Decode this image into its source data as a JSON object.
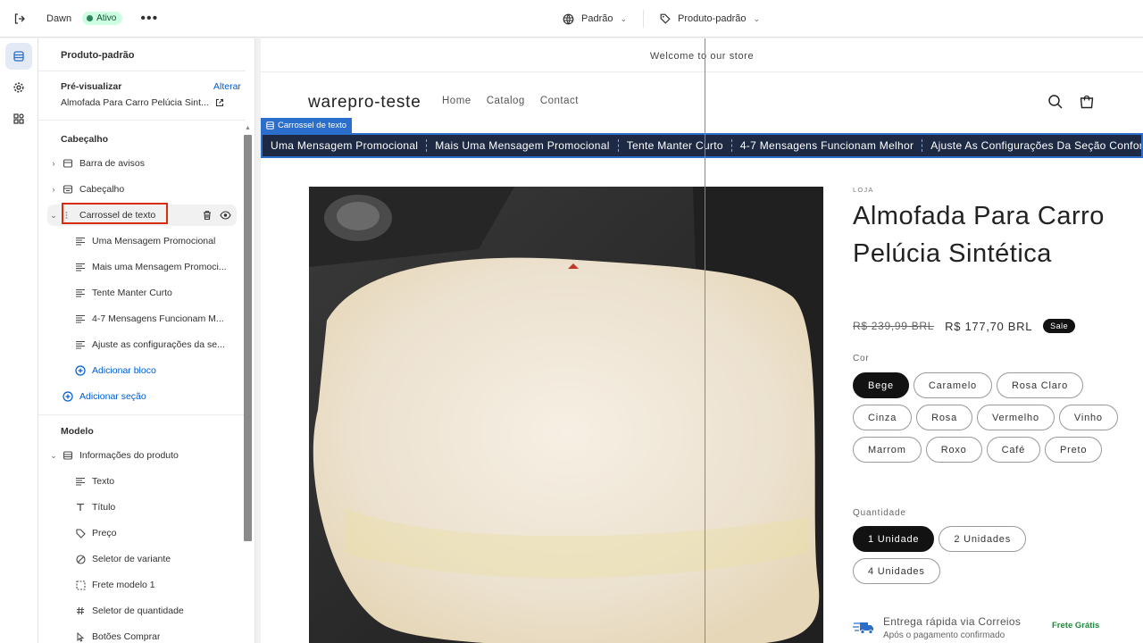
{
  "topbar": {
    "theme_name": "Dawn",
    "status": "Ativo",
    "more": "•••",
    "language_label": "Padrão",
    "template_label": "Produto-padrão"
  },
  "sidebar": {
    "title": "Produto-padrão",
    "preview_label": "Pré-visualizar",
    "change_label": "Alterar",
    "preview_product": "Almofada Para Carro Pelúcia Sint...",
    "header_section_title": "Cabeçalho",
    "header_items": [
      "Barra de avisos",
      "Cabeçalho",
      "Carrossel de texto"
    ],
    "carousel_blocks": [
      "Uma Mensagem Promocional",
      "Mais uma Mensagem Promoci...",
      "Tente Manter Curto",
      "4-7 Mensagens Funcionam M...",
      "Ajuste as configurações da se..."
    ],
    "add_block": "Adicionar bloco",
    "add_section": "Adicionar seção",
    "template_section_title": "Modelo",
    "product_info": "Informações do produto",
    "product_blocks": [
      "Texto",
      "Título",
      "Preço",
      "Seletor de variante",
      "Frete modelo 1",
      "Seletor de quantidade",
      "Botões Comprar"
    ]
  },
  "preview": {
    "announcement": "Welcome to our store",
    "store_name": "warepro-teste",
    "nav": [
      "Home",
      "Catalog",
      "Contact"
    ],
    "carousel_tag": "Carrossel de texto",
    "carousel_messages": [
      "Uma Mensagem Promocional",
      "Mais Uma Mensagem Promocional",
      "Tente Manter Curto",
      "4-7 Mensagens Funcionam Melhor",
      "Ajuste As Configurações Da Seção Conforme Nec"
    ],
    "vendor": "LOJA",
    "product_title": "Almofada Para Carro Pelúcia Sintética",
    "price_old": "R$ 239,99 BRL",
    "price_new": "R$ 177,70 BRL",
    "sale_badge": "Sale",
    "color_label": "Cor",
    "colors": [
      "Bege",
      "Caramelo",
      "Rosa Claro",
      "Cinza",
      "Rosa",
      "Vermelho",
      "Vinho",
      "Marrom",
      "Roxo",
      "Café",
      "Preto"
    ],
    "color_selected": "Bege",
    "quantity_label": "Quantidade",
    "quantities": [
      "1 Unidade",
      "2 Unidades",
      "4 Unidades"
    ],
    "quantity_selected": "1 Unidade",
    "shipping_title": "Entrega rápida via Correios",
    "shipping_sub": "Após o pagamento confirmado",
    "shipping_free": "Frete Grátis"
  },
  "colors": {
    "accent": "#2c6ecb",
    "carousel_bg": "#1e2a44",
    "highlight": "#d72c0d",
    "link": "#005bd3"
  }
}
